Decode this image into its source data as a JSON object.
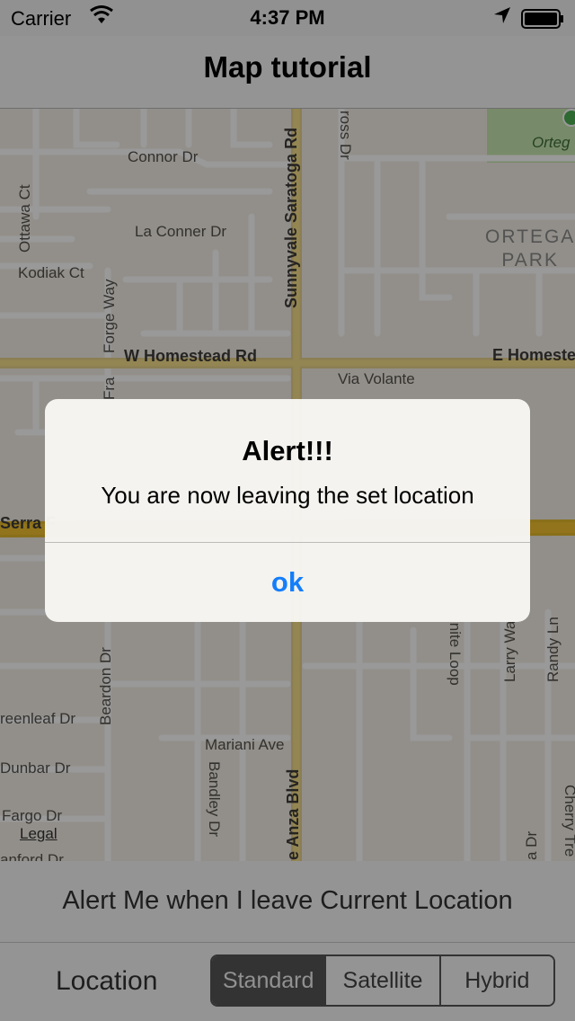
{
  "status_bar": {
    "carrier": "Carrier",
    "time": "4:37 PM",
    "wifi_icon": "wifi-icon",
    "location_icon": "location-arrow-icon",
    "battery_icon": "battery-icon"
  },
  "nav": {
    "title": "Map tutorial"
  },
  "map": {
    "streets": {
      "connor": "Connor Dr",
      "la_conner": "La Conner Dr",
      "ottawa": "Ottawa Ct",
      "kodiak": "Kodiak Ct",
      "forge": "Forge Way",
      "fra": "Fra",
      "w_homestead": "W Homestead Rd",
      "e_homestead": "E Homeste",
      "via_volante": "Via Volante",
      "sunnyvale_saratoga": "Sunnyvale Saratoga Rd",
      "ross": "ross Dr",
      "serra": "Serra F",
      "beardon": "Beardon Dr",
      "greenleaf": "reenleaf Dr",
      "dunbar": "Dunbar Dr",
      "fargo": "Fargo Dr",
      "lanford": "anford Dr",
      "mariani": "Mariani Ave",
      "bandley": "Bandley Dr",
      "de_anza": "e Anza Blvd",
      "infinite_loop": "inite Loop",
      "larry_way": "Larry Wa",
      "randy": "Randy Ln",
      "cherry": "Cherry Tre",
      "a_dr": "a Dr",
      "ortega_park_top": "Orteg",
      "ortega_park_1": "ORTEGA",
      "ortega_park_2": "PARK"
    },
    "legal": "Legal",
    "colors": {
      "land": "#f3efe6",
      "minor_road": "#ffffff",
      "major_road": "#f7d774",
      "freeway": "#f2c230",
      "park": "#c7e6b0"
    }
  },
  "alert_row": {
    "text": "Alert Me when I leave Current Location"
  },
  "bottom_bar": {
    "location_label": "Location",
    "segments": [
      "Standard",
      "Satellite",
      "Hybrid"
    ],
    "selected": "Standard"
  },
  "alert": {
    "title": "Alert!!!",
    "message": "You are now leaving the set location",
    "ok_label": "ok",
    "accent": "#147efb"
  }
}
